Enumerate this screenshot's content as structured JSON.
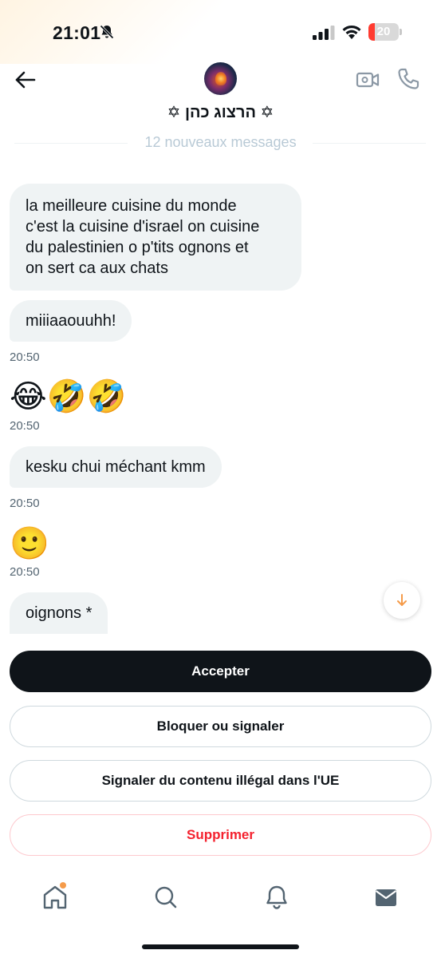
{
  "status_bar": {
    "time": "21:01",
    "battery_level": "20",
    "battery_fraction": 0.2
  },
  "header": {
    "contact_name": "✡ הרצוג כהן ✡",
    "new_messages_label": "12 nouveaux messages"
  },
  "messages": [
    {
      "text": "la meilleure cuisine du monde\nc'est la cuisine d'israel on cuisine\ndu palestinien o p'tits ognons et\non sert ca aux chats"
    },
    {
      "text": "miiiaaouuhh!",
      "time": "20:50"
    },
    {
      "text": "😂🤣🤣",
      "time": "20:50",
      "emoji_only": true
    },
    {
      "text": "kesku chui méchant kmm",
      "time": "20:50"
    },
    {
      "text": "🙂",
      "time": "20:50",
      "emoji_only": true
    },
    {
      "text": "oignons *"
    }
  ],
  "actions": {
    "accept": "Accepter",
    "block_report": "Bloquer ou signaler",
    "report_illegal": "Signaler du contenu illégal dans l'UE",
    "delete": "Supprimer"
  },
  "nav": {
    "items": [
      "home-icon",
      "search-icon",
      "notifications-icon",
      "messages-icon"
    ]
  },
  "colors": {
    "accent_orange": "#f59b4a",
    "danger": "#f4212e",
    "primary": "#0f1419"
  }
}
